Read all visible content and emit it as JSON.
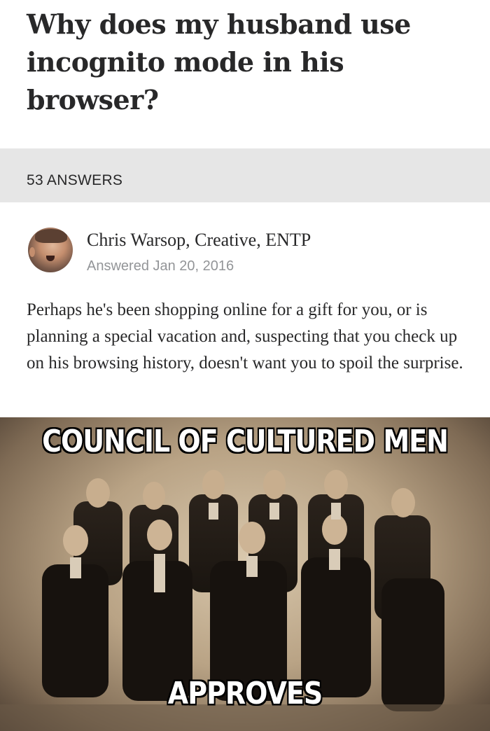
{
  "question": {
    "title": "Why does my husband use incognito mode in his browser?"
  },
  "answers_bar": {
    "count_label": "53 ANSWERS"
  },
  "answer": {
    "author": "Chris Warsop, Creative, ENTP",
    "answered": "Answered Jan 20, 2016",
    "text": "Perhaps he's been shopping online for a gift for you, or is planning a special vacation and, suspecting that you check up on his browsing history, doesn't want you to spoil the surprise."
  },
  "meme": {
    "top_caption": "COUNCIL OF CULTURED MEN",
    "bottom_caption": "APPROVES"
  }
}
